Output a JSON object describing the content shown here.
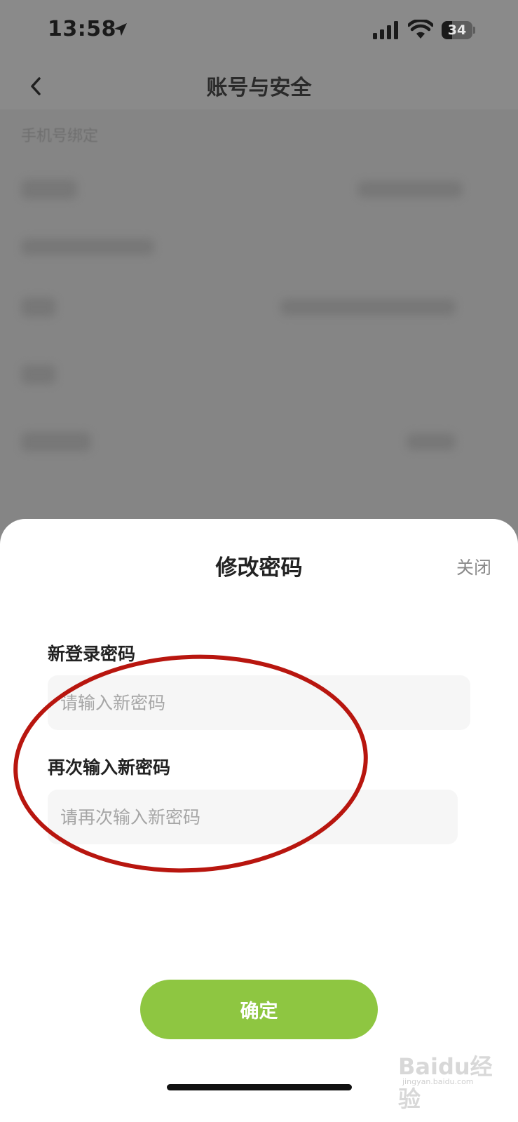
{
  "status_bar": {
    "time": "13:58",
    "battery": "34"
  },
  "nav": {
    "title": "账号与安全"
  },
  "background": {
    "section_label": "手机号绑定"
  },
  "sheet": {
    "title": "修改密码",
    "close_label": "关闭",
    "new_password_label": "新登录密码",
    "new_password_placeholder": "请输入新密码",
    "confirm_password_label": "再次输入新密码",
    "confirm_password_placeholder": "请再次输入新密码",
    "confirm_button": "确定"
  },
  "colors": {
    "accent": "#8ec641",
    "annotation": "#b8160f"
  },
  "watermark": {
    "text": "Baidu经验",
    "sub": "jingyan.baidu.com"
  }
}
